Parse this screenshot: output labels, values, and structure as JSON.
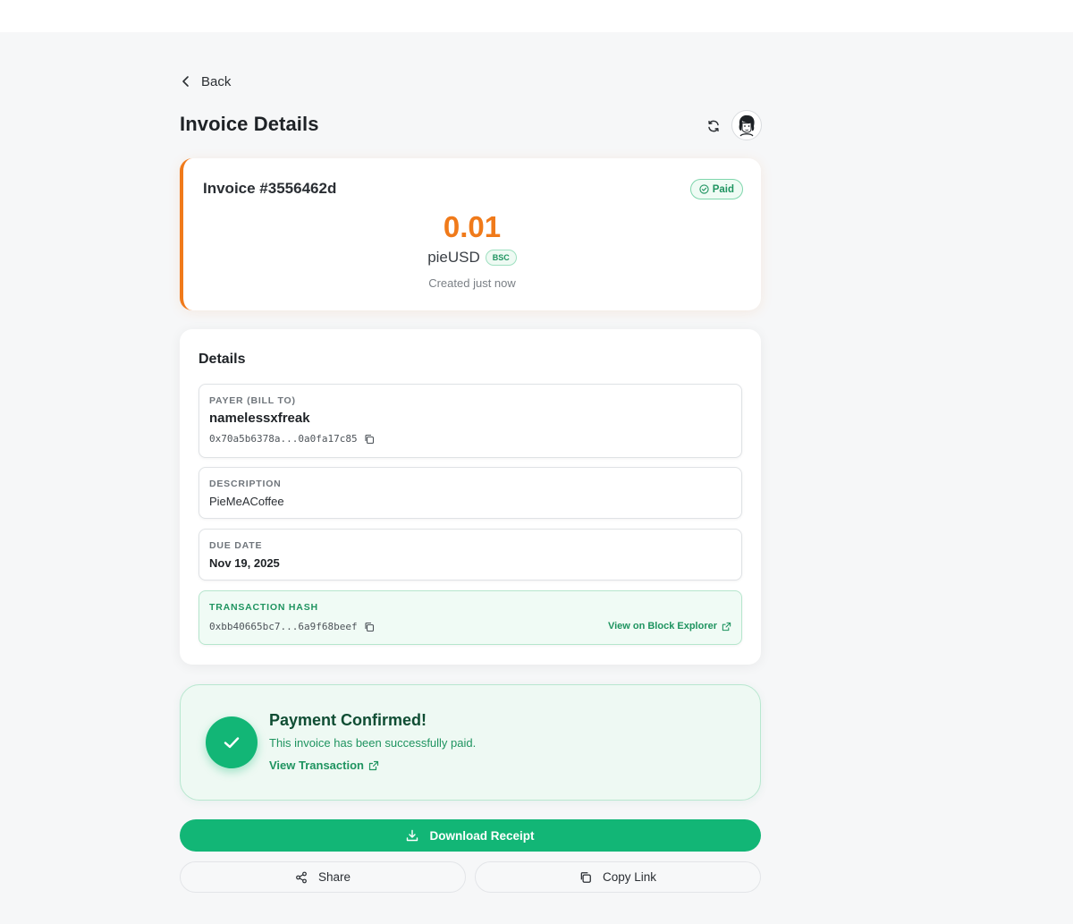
{
  "nav": {
    "back_label": "Back"
  },
  "header": {
    "title": "Invoice Details"
  },
  "invoice": {
    "number": "Invoice #3556462d",
    "status": "Paid",
    "amount": "0.01",
    "token": "pieUSD",
    "network": "BSC",
    "created": "Created just now"
  },
  "details": {
    "title": "Details",
    "payer": {
      "label": "PAYER (BILL TO)",
      "name": "namelessxfreak",
      "address": "0x70a5b6378a...0a0fa17c85"
    },
    "description": {
      "label": "DESCRIPTION",
      "value": "PieMeACoffee"
    },
    "due_date": {
      "label": "DUE DATE",
      "value": "Nov 19, 2025"
    },
    "tx": {
      "label": "TRANSACTION HASH",
      "hash": "0xbb40665bc7...6a9f68beef",
      "explorer_label": "View on Block Explorer"
    }
  },
  "confirmation": {
    "title": "Payment Confirmed!",
    "subtitle": "This invoice has been successfully paid.",
    "link_label": "View Transaction"
  },
  "actions": {
    "download_label": "Download Receipt",
    "share_label": "Share",
    "copy_link_label": "Copy Link"
  },
  "colors": {
    "accent_orange": "#f07a1a",
    "success_green": "#12b676",
    "success_text": "#1f9460"
  },
  "icons": [
    "chevron-left-icon",
    "refresh-icon",
    "avatar",
    "check-circle-icon",
    "copy-icon",
    "external-link-icon",
    "checkmark-icon",
    "download-icon",
    "share-icon"
  ]
}
